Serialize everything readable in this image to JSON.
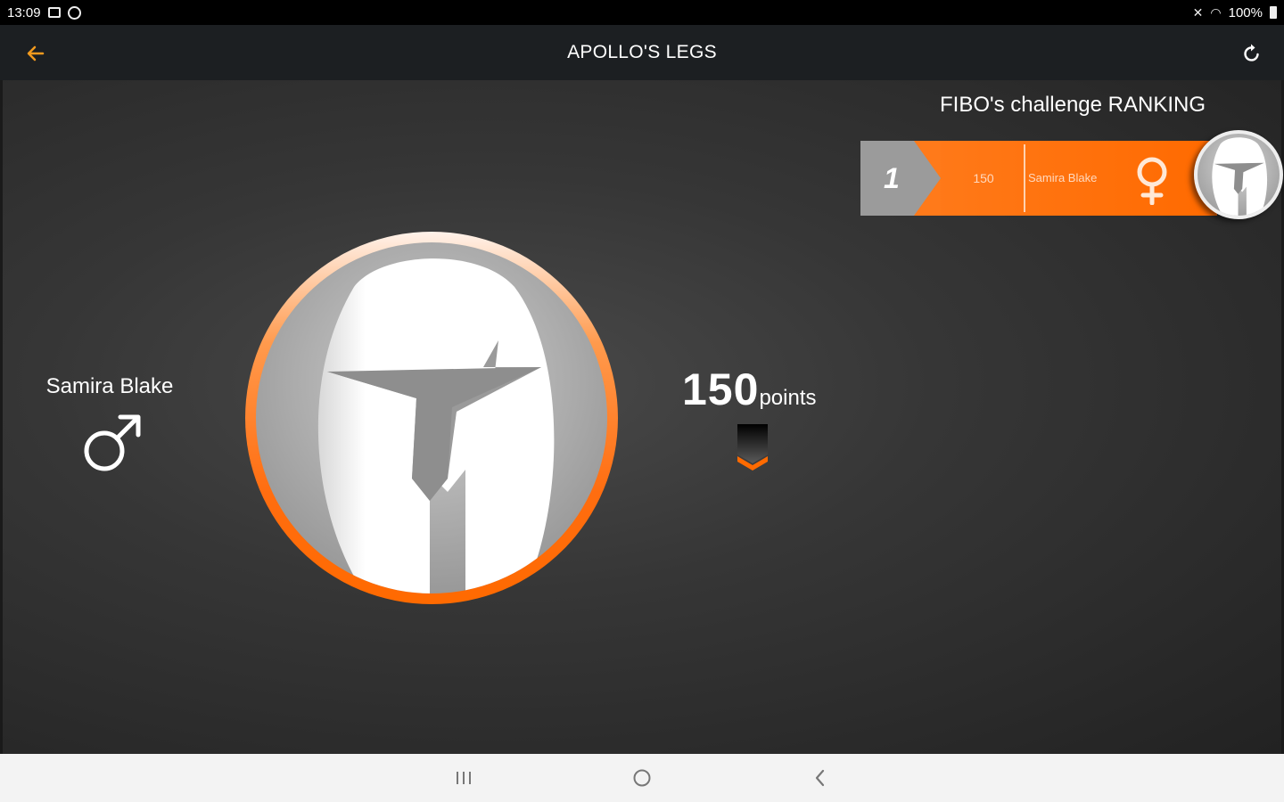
{
  "status_bar": {
    "time": "13:09",
    "battery": "100%"
  },
  "app_bar": {
    "title": "APOLLO'S LEGS",
    "back_icon": "arrow-left-icon",
    "refresh_icon": "refresh-icon"
  },
  "profile": {
    "name": "Samira Blake",
    "gender_icon": "male-icon",
    "points": "150",
    "points_unit": "points"
  },
  "ranking": {
    "title": "FIBO's challenge RANKING",
    "rows": [
      {
        "rank": "1",
        "points": "150",
        "name": "Samira Blake",
        "gender_icon": "female-icon"
      }
    ]
  },
  "colors": {
    "accent": "#ff6a00",
    "app_bar_bg": "#1c1f22",
    "back_arrow": "#f39a1e"
  },
  "nav_bar": {
    "icons": [
      "recent-apps-icon",
      "home-icon",
      "back-icon"
    ]
  }
}
